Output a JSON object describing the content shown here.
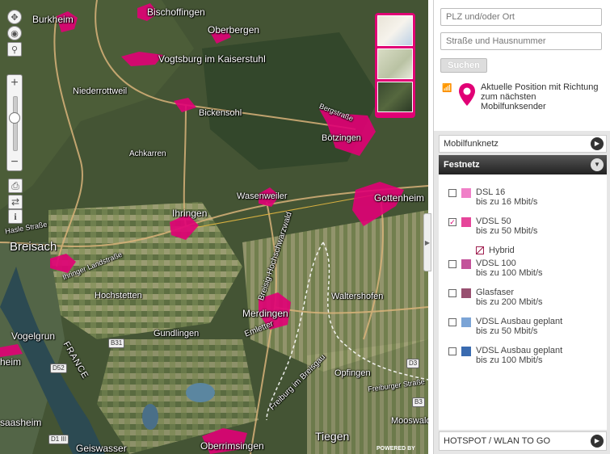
{
  "map": {
    "labels": {
      "burkheim": "Burkheim",
      "bischoffingen": "Bischoffingen",
      "oberbergen": "Oberbergen",
      "vogtsburg": "Vogtsburg im Kaiserstuhl",
      "niederrotweil": "Niederrottweil",
      "bickensohl": "Bickensohl",
      "bergstrasse": "Bergstraße",
      "botzingen": "Bötzingen",
      "achkarren": "Achkarren",
      "wasenweiler": "Wasenweiler",
      "gottenheim": "Gottenheim",
      "ihringen": "Ihringen",
      "breisach": "Breisach",
      "ihringer_landstrasse": "Ihringer Landstraße",
      "hochstetten": "Hochstetten",
      "waltershofen": "Waltershofen",
      "merdingen": "Merdingen",
      "vogelgrun": "Vogelgrun",
      "gundlingen": "Gundlingen",
      "emletter": "Emletter",
      "breisig_hochschwarzwald": "Breisig-Hochschwarzwald",
      "breisig_str": "Breisig-Hochschwarzwald",
      "freiburg_breisgau": "Freiburg im Breisgau",
      "opfingen": "Opfingen",
      "freiburger_strasse": "Freiburger Straße",
      "france": "FRANCE",
      "heim": "heim",
      "saasheim": "saasheim",
      "geiswasser": "Geiswasser",
      "oberrimsingen": "Oberrimsingen",
      "tiegen": "Tiegen",
      "mooswald": "Mooswald",
      "hasle_strasse": "Hasle Straße",
      "powered": "POWERED BY"
    },
    "shields": {
      "b31": "B31",
      "d52": "D52",
      "d1iii": "D1 III",
      "d3": "D3",
      "b3": "B3"
    },
    "colors": {
      "pink": "#e10075",
      "road": "#d9b37a"
    }
  },
  "sidebar": {
    "search": {
      "plz_placeholder": "PLZ und/oder Ort",
      "street_placeholder": "Straße und Hausnummer",
      "button": "Suchen"
    },
    "position": {
      "text": "Aktuelle Position mit Richtung zum nächsten Mobilfunksender"
    },
    "sections": {
      "mobilfunk": "Mobilfunknetz",
      "festnetz": "Festnetz",
      "hotspot": "HOTSPOT / WLAN TO GO"
    },
    "festnetz_items": [
      {
        "title": "DSL 16",
        "sub": "bis zu 16 Mbit/s",
        "checked": false,
        "color": "#f080c8"
      },
      {
        "title": "VDSL 50",
        "sub": "bis zu 50 Mbit/s",
        "checked": true,
        "color": "#e6459a"
      },
      {
        "title": "VDSL 100",
        "sub": "bis zu 100 Mbit/s",
        "checked": false,
        "color": "#c3529a"
      },
      {
        "title": "Glasfaser",
        "sub": "bis zu 200 Mbit/s",
        "checked": false,
        "color": "#985070"
      },
      {
        "title": "VDSL Ausbau geplant",
        "sub": "bis zu 50 Mbit/s",
        "checked": false,
        "color": "#7ba4d6"
      },
      {
        "title": "VDSL Ausbau geplant",
        "sub": "bis zu 100 Mbit/s",
        "checked": false,
        "color": "#3a6bb0"
      }
    ],
    "hybrid": "Hybrid",
    "check_mark": "✓"
  }
}
